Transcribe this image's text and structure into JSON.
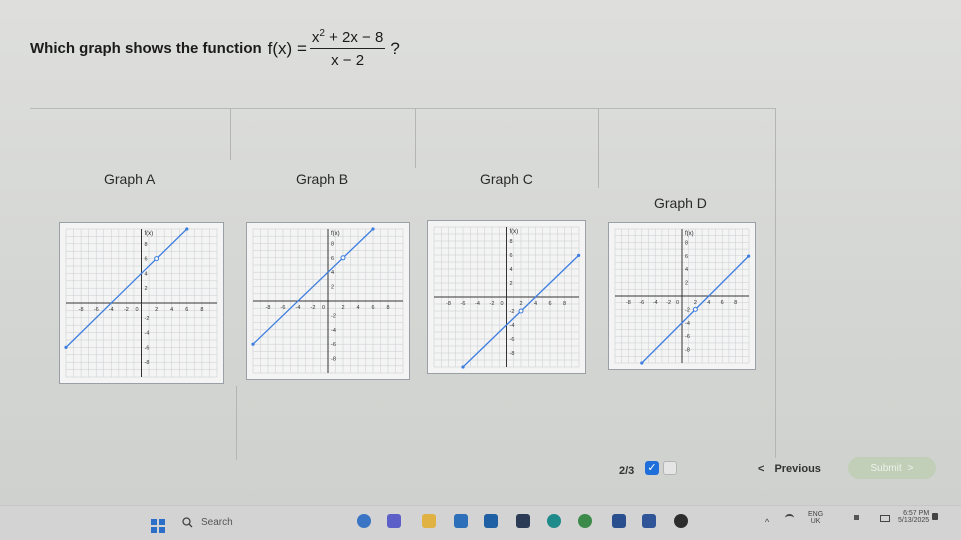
{
  "question": {
    "prefix": "Which graph shows the function",
    "func": "f(x) =",
    "numerator_base": "x",
    "numerator_exp": "2",
    "numerator_rest": " + 2x − 8",
    "denominator": "x − 2",
    "suffix": "?"
  },
  "graphs": [
    {
      "label": "Graph A",
      "ylabel": "f(x)",
      "slope": 1,
      "intercept": 4,
      "hole": [
        2,
        6
      ],
      "xticks": [
        "-8",
        "-6",
        "-4",
        "-2",
        "0",
        "2",
        "4",
        "6",
        "8"
      ],
      "yticks": [
        "8",
        "6",
        "4",
        "2",
        "-2",
        "-4",
        "-6",
        "-8"
      ]
    },
    {
      "label": "Graph B",
      "ylabel": "f(x)",
      "slope": 1,
      "intercept": 4,
      "hole": [
        2,
        6
      ],
      "xticks": [
        "-8",
        "-6",
        "-4",
        "-2",
        "0",
        "2",
        "4",
        "6",
        "8"
      ],
      "yticks": [
        "8",
        "6",
        "4",
        "2",
        "-2",
        "-4",
        "-6",
        "-8"
      ]
    },
    {
      "label": "Graph C",
      "ylabel": "f(x)",
      "slope": 1,
      "intercept": -4,
      "hole": [
        2,
        -2
      ],
      "xticks": [
        "-8",
        "-6",
        "-4",
        "-2",
        "0",
        "2",
        "4",
        "6",
        "8"
      ],
      "yticks": [
        "8",
        "6",
        "4",
        "2",
        "-2",
        "-4",
        "-6",
        "-8"
      ]
    },
    {
      "label": "Graph D",
      "ylabel": "f(x)",
      "slope": 1,
      "intercept": -4,
      "hole": [
        2,
        -2
      ],
      "xticks": [
        "-8",
        "-6",
        "-4",
        "-2",
        "0",
        "2",
        "4",
        "6",
        "8"
      ],
      "yticks": [
        "8",
        "6",
        "4",
        "2",
        "-2",
        "-4",
        "-6",
        "-8"
      ]
    }
  ],
  "nav": {
    "progress": "2/3",
    "check_mark": "✓",
    "previous_arrow": "<",
    "previous_label": "Previous",
    "submit_label": "Submit",
    "submit_arrow": ">"
  },
  "taskbar": {
    "search_placeholder": "Search",
    "lang_top": "ENG",
    "lang_bottom": "UK",
    "time": "6:57 PM",
    "date": "5/13/2025",
    "chevron": "^"
  },
  "colors": {
    "accent": "#1e6fd9",
    "line": "#3e7ee0",
    "grid": "#c9ccd0"
  }
}
